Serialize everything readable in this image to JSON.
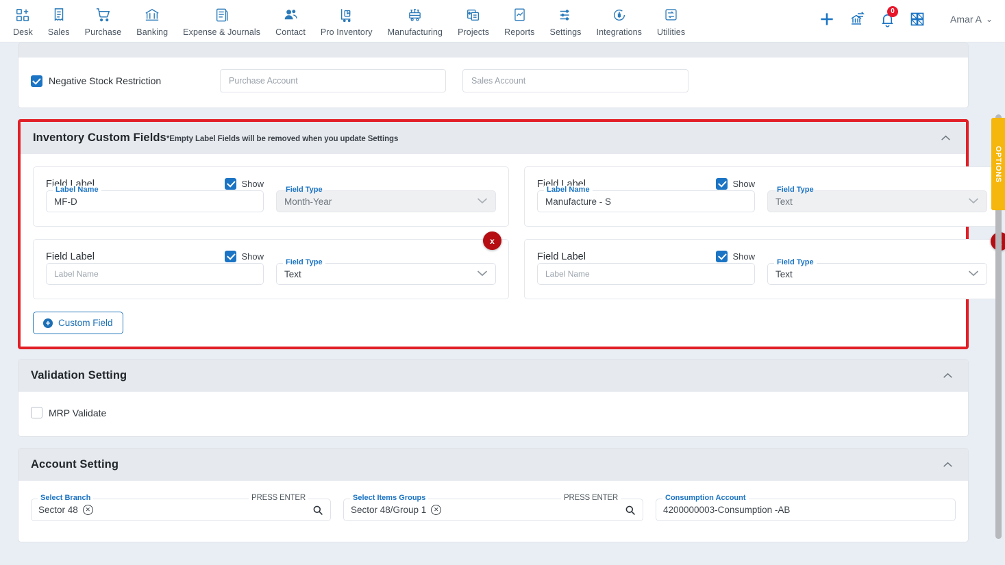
{
  "nav": {
    "items": [
      {
        "label": "Desk",
        "icon": "desk-grid-plus-icon"
      },
      {
        "label": "Sales",
        "icon": "sales-receipt-icon"
      },
      {
        "label": "Purchase",
        "icon": "purchase-cart-icon"
      },
      {
        "label": "Banking",
        "icon": "banking-bank-icon"
      },
      {
        "label": "Expense & Journals",
        "icon": "expense-journal-icon"
      },
      {
        "label": "Contact",
        "icon": "contact-people-icon"
      },
      {
        "label": "Pro Inventory",
        "icon": "pro-inventory-trolley-icon"
      },
      {
        "label": "Manufacturing",
        "icon": "manufacturing-machine-icon"
      },
      {
        "label": "Projects",
        "icon": "projects-clipboard-icon"
      },
      {
        "label": "Reports",
        "icon": "reports-chart-icon"
      },
      {
        "label": "Settings",
        "icon": "settings-sliders-icon"
      },
      {
        "label": "Integrations",
        "icon": "integrations-plug-icon"
      },
      {
        "label": "Utilities",
        "icon": "utilities-swap-icon"
      }
    ],
    "actions": [
      {
        "name": "add-icon",
        "glyph": "+"
      },
      {
        "name": "bank-transfer-icon",
        "glyph": ""
      },
      {
        "name": "notifications-bell-icon",
        "glyph": "",
        "badge": "0"
      },
      {
        "name": "apps-grid-icon",
        "glyph": ""
      }
    ],
    "user": {
      "name": "Amar A",
      "caret": "⌄"
    }
  },
  "negative_stock": {
    "checkbox_label": "Negative Stock Restriction",
    "checked": true,
    "purchase_account_placeholder": "Purchase Account",
    "sales_account_placeholder": "Sales Account"
  },
  "inventory_custom_fields": {
    "title": "Inventory Custom Fields",
    "subtitle": "*Empty Label Fields will be removed when you update Settings",
    "collapse_icon": "chevron-up-icon",
    "highlight_color": "#e11f26",
    "field_label_text": "Field Label",
    "show_text": "Show",
    "label_name_legend": "Label Name",
    "field_type_legend": "Field Type",
    "label_name_placeholder": "Label Name",
    "delete_glyph": "x",
    "cards": [
      {
        "label_value": "MF-D",
        "label_placeholder": "",
        "show": true,
        "field_type": "Month-Year",
        "type_disabled": true
      },
      {
        "label_value": "Manufacture - S",
        "label_placeholder": "",
        "show": true,
        "field_type": "Text",
        "type_disabled": true
      },
      {
        "label_value": "",
        "label_placeholder": "Label Name",
        "show": true,
        "field_type": "Text",
        "type_disabled": false
      },
      {
        "label_value": "",
        "label_placeholder": "Label Name",
        "show": true,
        "field_type": "Text",
        "type_disabled": false
      }
    ],
    "add_button_label": "Custom Field",
    "add_button_icon": "circle-plus-icon"
  },
  "validation_setting": {
    "title": "Validation Setting",
    "collapse_icon": "chevron-up-icon",
    "mrp_validate_label": "MRP Validate",
    "mrp_validate_checked": false
  },
  "account_setting": {
    "title": "Account Setting",
    "collapse_icon": "chevron-up-icon",
    "press_enter_hint": "PRESS ENTER",
    "fields": [
      {
        "legend": "Select Branch",
        "chip": "Sector 48",
        "hint": "PRESS ENTER",
        "icon": "search-icon"
      },
      {
        "legend": "Select Items Groups",
        "chip": "Sector 48/Group 1",
        "hint": "PRESS ENTER",
        "icon": "search-icon"
      },
      {
        "legend": "Consumption Account",
        "value": "4200000003-Consumption -AB"
      }
    ]
  },
  "options_tab": {
    "label": "OPTIONS",
    "color": "#f5b60d"
  }
}
